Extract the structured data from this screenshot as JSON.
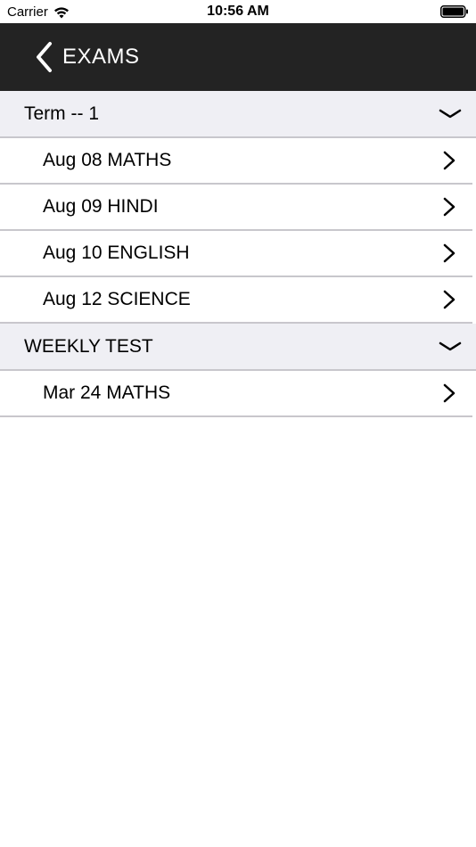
{
  "status_bar": {
    "carrier": "Carrier",
    "time": "10:56 AM"
  },
  "nav": {
    "title": "EXAMS"
  },
  "sections": [
    {
      "title": "Term -- 1",
      "items": [
        {
          "label": "Aug 08 MATHS"
        },
        {
          "label": "Aug 09 HINDI"
        },
        {
          "label": "Aug 10 ENGLISH"
        },
        {
          "label": "Aug 12 SCIENCE"
        }
      ]
    },
    {
      "title": "WEEKLY TEST",
      "items": [
        {
          "label": "Mar 24 MATHS"
        }
      ]
    }
  ],
  "colors": {
    "nav_background": "#232323",
    "section_background": "#efeff4",
    "separator": "#c8c7cc"
  },
  "icons": {
    "back": "chevron-left-icon",
    "section_toggle": "chevron-down-icon",
    "row_disclosure": "chevron-right-icon"
  }
}
